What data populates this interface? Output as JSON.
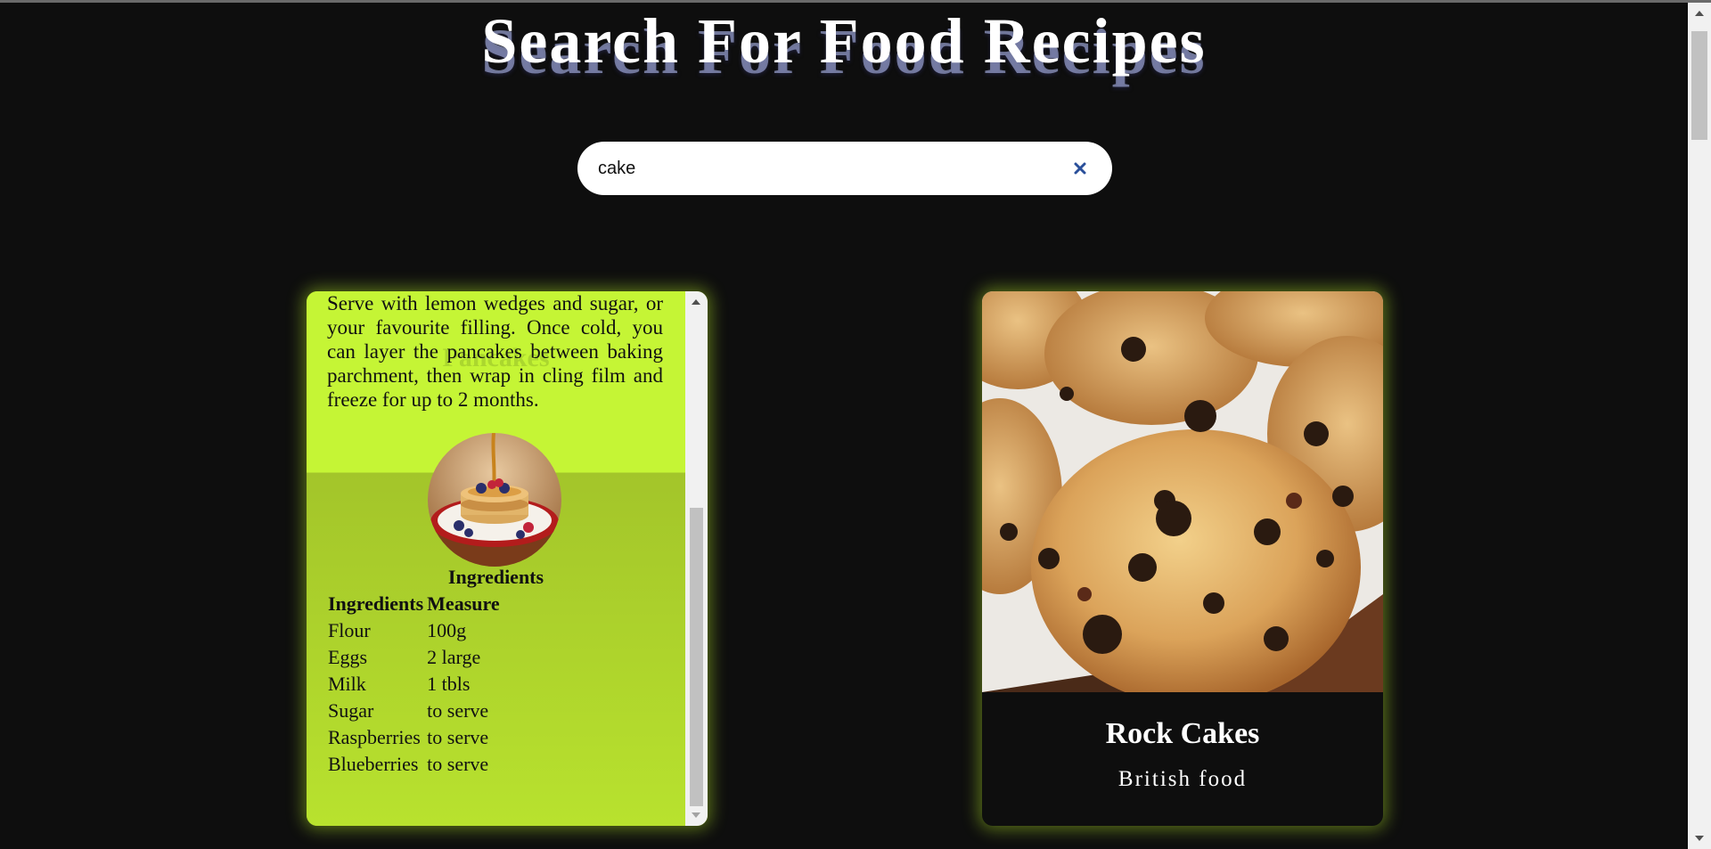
{
  "page": {
    "title": "Search For Food Recipes"
  },
  "search": {
    "value": "cake",
    "clear_icon": "close-icon"
  },
  "cards": [
    {
      "flipped": true,
      "title": "Pancakes",
      "instructions": "Serve with lemon wedges and sugar, or your favourite filling. Once cold, you can layer the pancakes between baking parchment, then wrap in cling film and freeze for up to 2 months.",
      "ingredients_heading": "Ingredients",
      "table": {
        "headers": [
          "Ingredients",
          "Measure"
        ],
        "rows": [
          [
            "Flour",
            "100g"
          ],
          [
            "Eggs",
            "2 large"
          ],
          [
            "Milk",
            "1 tbls"
          ],
          [
            "Sugar",
            "to serve"
          ],
          [
            "Raspberries",
            "to serve"
          ],
          [
            "Blueberries",
            "to serve"
          ]
        ]
      },
      "background_color": "#c5f535"
    },
    {
      "flipped": false,
      "title": "Rock Cakes",
      "subtitle": "British food"
    }
  ],
  "colors": {
    "page_background": "#0e0e0e",
    "card_glow": "#b4e628",
    "title_text": "#ffffff",
    "clear_icon": "#2a4f9a"
  }
}
